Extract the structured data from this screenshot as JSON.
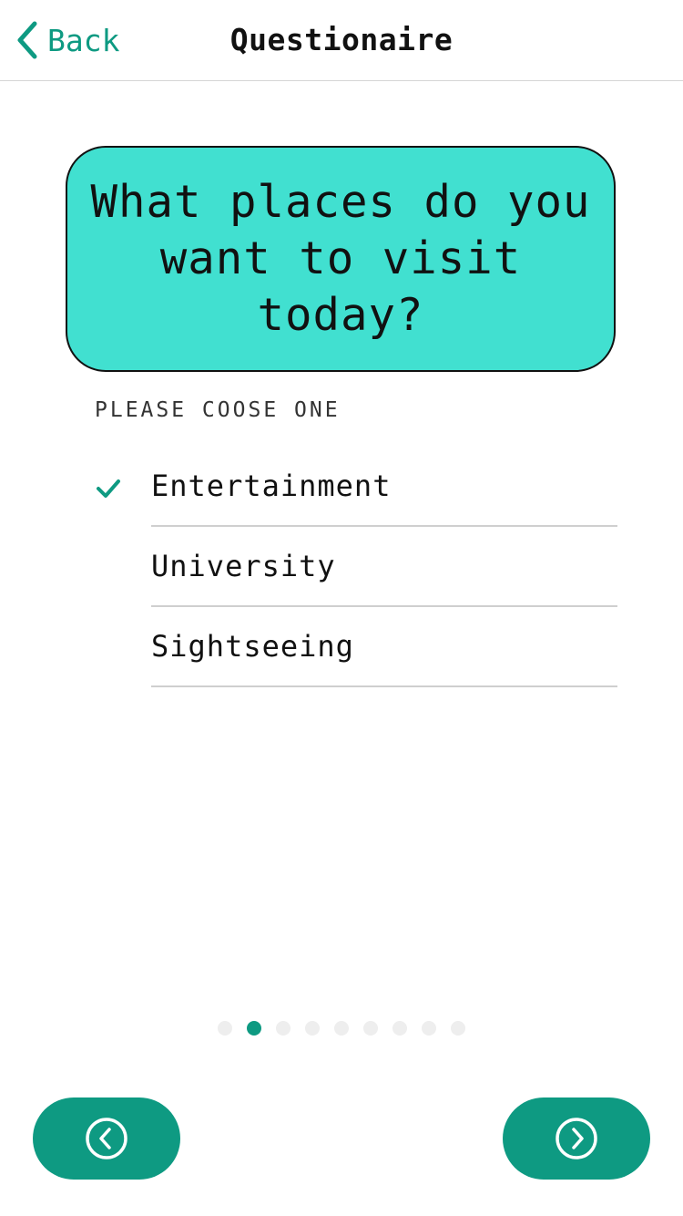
{
  "navbar": {
    "back_label": "Back",
    "title": "Questionaire"
  },
  "question": {
    "text": "What places do you want to visit today?"
  },
  "hint": "PLEASE COOSE ONE",
  "options": [
    {
      "label": "Entertainment",
      "selected": true
    },
    {
      "label": "University",
      "selected": false
    },
    {
      "label": "Sightseeing",
      "selected": false
    }
  ],
  "pagination": {
    "total_pages": 9,
    "current_page": 2
  },
  "colors": {
    "accent": "#0e9a82",
    "card": "#41e0d0"
  },
  "icons": {
    "back": "chevron-left-icon",
    "check": "checkmark-icon",
    "prev": "circle-chevron-left-icon",
    "next": "circle-chevron-right-icon"
  }
}
